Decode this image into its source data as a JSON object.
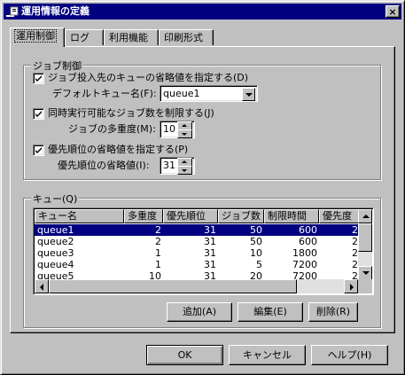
{
  "window": {
    "title": "運用情報の定義",
    "close_label": "×"
  },
  "tabs": [
    {
      "label": "運用制御"
    },
    {
      "label": "ログ"
    },
    {
      "label": "利用機能"
    },
    {
      "label": "印刷形式"
    }
  ],
  "job_control": {
    "group_label": "ジョブ制御",
    "default_queue_check": {
      "label": "ジョブ投入先のキューの省略値を指定する(D)",
      "checked": true
    },
    "default_queue_label": "デフォルトキュー名(F):",
    "default_queue_value": "queue1",
    "limit_jobs_check": {
      "label": "同時実行可能なジョブ数を制限する(J)",
      "checked": true
    },
    "multiplicity_label": "ジョブの多重度(M):",
    "multiplicity_value": "10",
    "priority_check": {
      "label": "優先順位の省略値を指定する(P)",
      "checked": true
    },
    "priority_label": "優先順位の省略値(I):",
    "priority_value": "31"
  },
  "queue": {
    "group_label": "キュー(Q)",
    "columns": [
      "キュー名",
      "多重度",
      "優先順位",
      "ジョブ数",
      "制限時間",
      "優先度"
    ],
    "rows": [
      [
        "queue1",
        "2",
        "31",
        "50",
        "600",
        "2"
      ],
      [
        "queue2",
        "2",
        "31",
        "50",
        "600",
        "2"
      ],
      [
        "queue3",
        "1",
        "31",
        "10",
        "1800",
        "2"
      ],
      [
        "queue4",
        "1",
        "31",
        "5",
        "7200",
        "2"
      ],
      [
        "queue5",
        "10",
        "31",
        "20",
        "7200",
        "2"
      ]
    ],
    "add_label": "追加(A)",
    "edit_label": "編集(E)",
    "delete_label": "削除(R)"
  },
  "footer": {
    "ok_label": "OK",
    "cancel_label": "キャンセル",
    "help_label": "ヘルプ(H)"
  },
  "colors": {
    "titlebar": "#000080",
    "face": "#c0c0c0",
    "selection": "#000080"
  }
}
